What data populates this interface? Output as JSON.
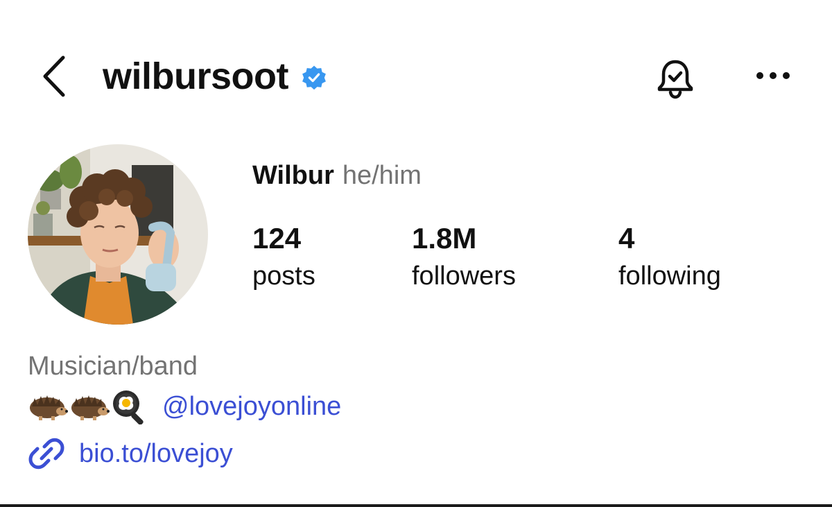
{
  "header": {
    "username": "wilbursoot",
    "icons": {
      "back": "back-chevron-icon",
      "verified": "verified-badge-icon",
      "notifications": "bell-notification-icon",
      "more": "more-dots-icon"
    }
  },
  "profile": {
    "display_name": "Wilbur",
    "pronouns": "he/him",
    "stats": [
      {
        "count": "124",
        "label": "posts"
      },
      {
        "count": "1.8M",
        "label": "followers"
      },
      {
        "count": "4",
        "label": "following"
      }
    ]
  },
  "bio": {
    "category": "Musician/band",
    "emojis": [
      "hedgehog-emoji",
      "hedgehog-emoji",
      "frying-pan-egg-emoji"
    ],
    "mention": "@lovejoyonline",
    "link": "bio.to/lovejoy",
    "link_icon": "link-chain-icon"
  },
  "colors": {
    "text": "#111111",
    "secondary_text": "#737373",
    "link": "#3b4fd4",
    "verified": "#3897f0"
  }
}
